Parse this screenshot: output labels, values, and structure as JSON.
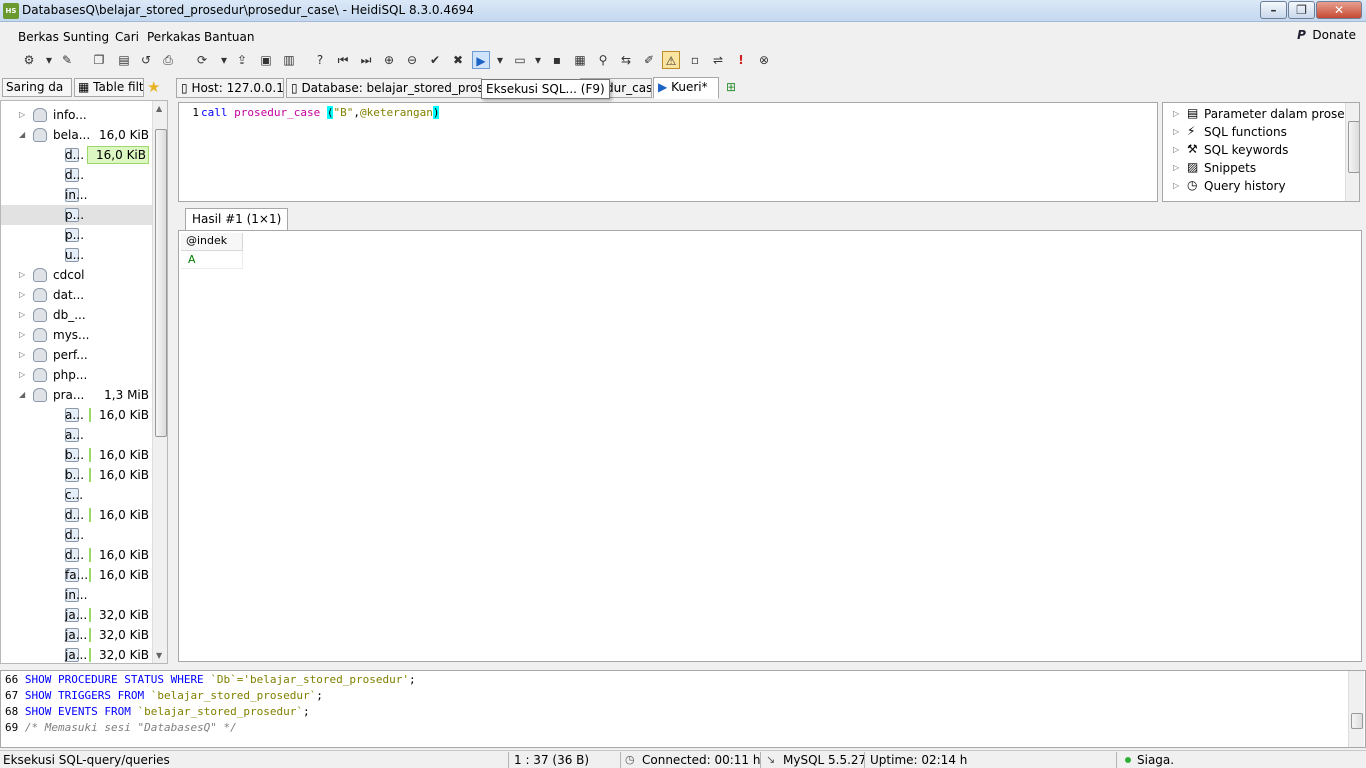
{
  "window": {
    "app_icon": "HS",
    "title": "DatabasesQ\\belajar_stored_prosedur\\prosedur_case\\ - HeidiSQL 8.3.0.4694",
    "minimize": "–",
    "maximize": "❐",
    "close": "✕"
  },
  "menu": {
    "items": [
      "Berkas",
      "Sunting",
      "Cari",
      "Perkakas",
      "Bantuan"
    ],
    "donate": "Donate",
    "donate_icon": "P"
  },
  "toolbar": {
    "icons": [
      "connect",
      "dropdown",
      "disconnect",
      "copy",
      "paste",
      "undo-arrow",
      "print",
      "refresh",
      "dropdown",
      "export",
      "import",
      "copy-sql",
      "help",
      "first",
      "last",
      "add",
      "remove",
      "apply",
      "cancel",
      "execute",
      "dropdown",
      "save-folder",
      "dropdown",
      "save",
      "save-all",
      "binoculars",
      "replace",
      "edit",
      "warning",
      "clear",
      "wrap",
      "exclamation",
      "stop"
    ]
  },
  "left_tabs": {
    "filter": "Saring da",
    "table_filter": "Table filte",
    "star": "★"
  },
  "tabs": {
    "host": "Host: 127.0.0.1",
    "database": "Database: belajar_stored_pros...",
    "routine": "osedur_case",
    "query": "Kueri*"
  },
  "tooltip": "Eksekusi SQL... (F9)",
  "tree": [
    {
      "exp": "▷",
      "name": "info...",
      "size": "",
      "level": 0,
      "type": "db"
    },
    {
      "exp": "◢",
      "name": "bela...",
      "size": "16,0 KiB",
      "level": 0,
      "type": "db"
    },
    {
      "exp": "",
      "name": "d...",
      "size": "16,0 KiB",
      "level": 1,
      "type": "table",
      "highlight": true
    },
    {
      "exp": "",
      "name": "d...",
      "size": "",
      "level": 1,
      "type": "proc"
    },
    {
      "exp": "",
      "name": "in...",
      "size": "",
      "level": 1,
      "type": "proc"
    },
    {
      "exp": "",
      "name": "p...",
      "size": "",
      "level": 1,
      "type": "proc",
      "selected": true
    },
    {
      "exp": "",
      "name": "p...",
      "size": "",
      "level": 1,
      "type": "proc"
    },
    {
      "exp": "",
      "name": "u...",
      "size": "",
      "level": 1,
      "type": "proc"
    },
    {
      "exp": "▷",
      "name": "cdcol",
      "size": "",
      "level": 0,
      "type": "db"
    },
    {
      "exp": "▷",
      "name": "dat...",
      "size": "",
      "level": 0,
      "type": "db"
    },
    {
      "exp": "▷",
      "name": "db_...",
      "size": "",
      "level": 0,
      "type": "db"
    },
    {
      "exp": "▷",
      "name": "mys...",
      "size": "",
      "level": 0,
      "type": "db"
    },
    {
      "exp": "▷",
      "name": "perf...",
      "size": "",
      "level": 0,
      "type": "db"
    },
    {
      "exp": "▷",
      "name": "php...",
      "size": "",
      "level": 0,
      "type": "db"
    },
    {
      "exp": "◢",
      "name": "pra...",
      "size": "1,3 MiB",
      "level": 0,
      "type": "db"
    },
    {
      "exp": "",
      "name": "a...",
      "size": "16,0 KiB",
      "level": 1,
      "type": "table",
      "bar": true
    },
    {
      "exp": "",
      "name": "a...",
      "size": "",
      "level": 1,
      "type": "proc"
    },
    {
      "exp": "",
      "name": "b...",
      "size": "16,0 KiB",
      "level": 1,
      "type": "table",
      "bar": true
    },
    {
      "exp": "",
      "name": "b...",
      "size": "16,0 KiB",
      "level": 1,
      "type": "table",
      "bar": true
    },
    {
      "exp": "",
      "name": "c...",
      "size": "",
      "level": 1,
      "type": "proc"
    },
    {
      "exp": "",
      "name": "d...",
      "size": "16,0 KiB",
      "level": 1,
      "type": "table",
      "bar": true
    },
    {
      "exp": "",
      "name": "d...",
      "size": "",
      "level": 1,
      "type": "proc"
    },
    {
      "exp": "",
      "name": "d...",
      "size": "16,0 KiB",
      "level": 1,
      "type": "table",
      "bar": true
    },
    {
      "exp": "",
      "name": "fa...",
      "size": "16,0 KiB",
      "level": 1,
      "type": "table",
      "bar": true
    },
    {
      "exp": "",
      "name": "in...",
      "size": "",
      "level": 1,
      "type": "proc"
    },
    {
      "exp": "",
      "name": "ja...",
      "size": "32,0 KiB",
      "level": 1,
      "type": "table",
      "bar": true
    },
    {
      "exp": "",
      "name": "ja...",
      "size": "32,0 KiB",
      "level": 1,
      "type": "table",
      "bar": true
    },
    {
      "exp": "",
      "name": "ja...",
      "size": "32,0 KiB",
      "level": 1,
      "type": "table",
      "bar": true
    }
  ],
  "editor": {
    "line_number": "1",
    "kw_call": "call",
    "proc_name": "prosedur_case",
    "paren_open": "(",
    "arg_string": "\"B\"",
    "comma": ",",
    "arg_var": "@keterangan",
    "paren_close": ")"
  },
  "helpers": [
    {
      "icon": "▤",
      "label": "Parameter dalam prosed..."
    },
    {
      "icon": "⚡",
      "label": "SQL functions"
    },
    {
      "icon": "⚒",
      "label": "SQL keywords"
    },
    {
      "icon": "▨",
      "label": "Snippets"
    },
    {
      "icon": "◷",
      "label": "Query history"
    }
  ],
  "result": {
    "tab_label": "Hasil #1 (1×1)",
    "column": "@indek",
    "value": "A"
  },
  "log": [
    {
      "num": "66",
      "parts": [
        [
          "kw",
          "SHOW PROCEDURE STATUS WHERE "
        ],
        [
          "str",
          "`Db`='belajar_stored_prosedur'"
        ],
        [
          "",
          "; "
        ]
      ]
    },
    {
      "num": "67",
      "parts": [
        [
          "kw",
          "SHOW TRIGGERS FROM "
        ],
        [
          "str",
          "`belajar_stored_prosedur`"
        ],
        [
          "",
          "; "
        ]
      ]
    },
    {
      "num": "68",
      "parts": [
        [
          "kw",
          "SHOW EVENTS FROM "
        ],
        [
          "str",
          "`belajar_stored_prosedur`"
        ],
        [
          "",
          "; "
        ]
      ]
    },
    {
      "num": "69",
      "parts": [
        [
          "cm",
          "/* Memasuki sesi \"DatabasesQ\" */"
        ]
      ]
    }
  ],
  "status": {
    "message": "Eksekusi SQL-query/queries",
    "cursor": "1 : 37 (36 B)",
    "connected": "Connected: 00:11 h",
    "server": "MySQL 5.5.27",
    "uptime": "Uptime: 02:14 h",
    "state": "Siaga."
  },
  "colors": {
    "keyword": "#0000ff",
    "function": "#c5009f",
    "string": "#808000",
    "highlight": "#00ffff",
    "value": "#008000",
    "size_bar": "#9cd86a"
  }
}
